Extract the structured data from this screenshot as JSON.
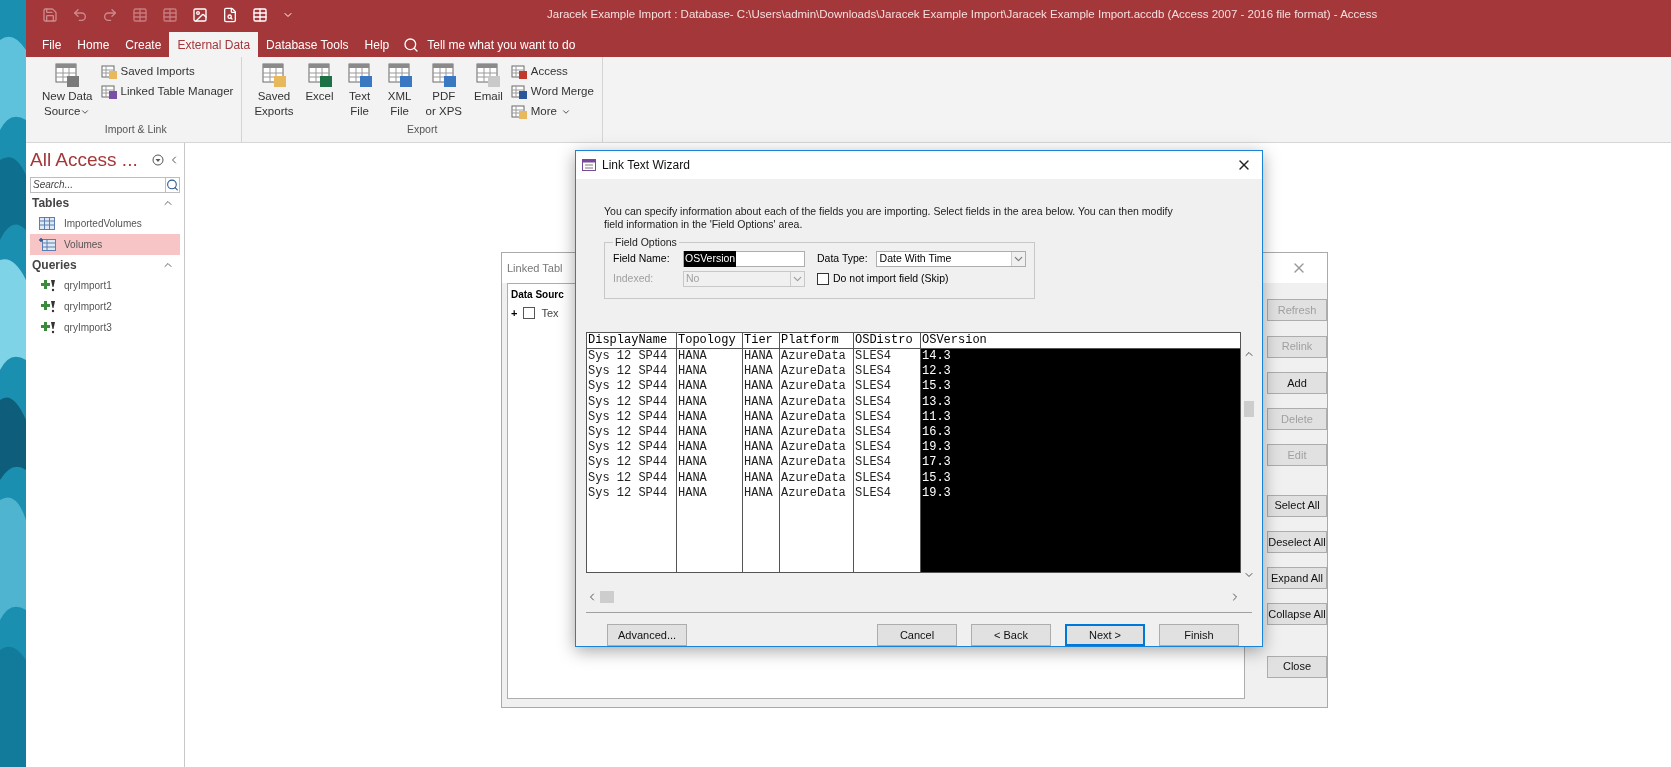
{
  "app_window": {
    "title": "Jaracek Example Import : Database- C:\\Users\\admin\\Downloads\\Jaracek Example Import\\Jaracek Example Import.accdb (Access 2007 - 2016 file format)  -  Access"
  },
  "ribbon_tabs": [
    {
      "label": "File",
      "selected": false
    },
    {
      "label": "Home",
      "selected": false
    },
    {
      "label": "Create",
      "selected": false
    },
    {
      "label": "External Data",
      "selected": true
    },
    {
      "label": "Database Tools",
      "selected": false
    },
    {
      "label": "Help",
      "selected": false
    }
  ],
  "tell_me": "Tell me what you want to do",
  "ribbon_groups": [
    {
      "label": "Import & Link",
      "items": [
        {
          "kind": "large",
          "lines": [
            "New Data",
            "Source"
          ],
          "dropdown": true
        },
        {
          "kind": "small",
          "lines": [
            "Saved Imports"
          ],
          "dropdown": false
        },
        {
          "kind": "small",
          "lines": [
            "Linked Table Manager"
          ],
          "dropdown": false
        }
      ]
    },
    {
      "label": "Export",
      "items": [
        {
          "kind": "large",
          "lines": [
            "Saved",
            "Exports"
          ],
          "dropdown": false
        },
        {
          "kind": "large",
          "lines": [
            "Excel"
          ],
          "dropdown": false
        },
        {
          "kind": "large",
          "lines": [
            "Text",
            "File"
          ],
          "dropdown": false
        },
        {
          "kind": "large",
          "lines": [
            "XML",
            "File"
          ],
          "dropdown": false
        },
        {
          "kind": "large",
          "lines": [
            "PDF",
            "or XPS"
          ],
          "dropdown": false
        },
        {
          "kind": "large",
          "lines": [
            "Email"
          ],
          "dropdown": false
        },
        {
          "kind": "small",
          "lines": [
            "Access"
          ],
          "dropdown": false
        },
        {
          "kind": "small",
          "lines": [
            "Word Merge"
          ],
          "dropdown": false
        },
        {
          "kind": "small",
          "lines": [
            "More"
          ],
          "dropdown": true
        }
      ]
    }
  ],
  "nav_pane": {
    "title": "All Access ...",
    "search_placeholder": "Search...",
    "sections": [
      {
        "label": "Tables",
        "items": [
          {
            "label": "ImportedVolumes",
            "kind": "table",
            "selected": false
          },
          {
            "label": "Volumes",
            "kind": "linked_table",
            "selected": true
          }
        ]
      },
      {
        "label": "Queries",
        "items": [
          {
            "label": "qryImport1",
            "kind": "query",
            "selected": false
          },
          {
            "label": "qryImport2",
            "kind": "query",
            "selected": false
          },
          {
            "label": "qryImport3",
            "kind": "query",
            "selected": false
          }
        ]
      }
    ]
  },
  "linked_table_manager": {
    "title": "Linked Tabl",
    "tree_header": "Data Sourc",
    "tree_items": [
      {
        "expander": "+",
        "label": "Tex",
        "checked": false
      }
    ],
    "buttons": [
      {
        "label": "Refresh",
        "disabled": true
      },
      {
        "label": "Relink",
        "disabled": true
      },
      {
        "label": "Add",
        "disabled": false
      },
      {
        "label": "Delete",
        "disabled": true
      },
      {
        "label": "Edit",
        "disabled": true
      },
      {
        "label": "Select All",
        "disabled": false
      },
      {
        "label": "Deselect All",
        "disabled": false
      },
      {
        "label": "Expand All",
        "disabled": false
      },
      {
        "label": "Collapse All",
        "disabled": false
      },
      {
        "label": "Close",
        "disabled": false
      }
    ]
  },
  "wizard": {
    "title": "Link Text Wizard",
    "instructions": "You can specify information about each of the fields you are importing. Select fields in the area below. You can then modify field information in the 'Field Options' area.",
    "field_options": {
      "legend": "Field Options",
      "field_name_label": "Field Name:",
      "field_name_value": "OSVersion",
      "data_type_label": "Data Type:",
      "data_type_value": "Date With Time",
      "indexed_label": "Indexed:",
      "indexed_value": "No",
      "indexed_disabled": true,
      "skip_label": "Do not import field (Skip)",
      "skip_checked": false
    },
    "table": {
      "columns": [
        {
          "label": "DisplayName",
          "selected": false
        },
        {
          "label": "Topology",
          "selected": false
        },
        {
          "label": "Tier",
          "selected": false
        },
        {
          "label": "Platform",
          "selected": false
        },
        {
          "label": "OSDistro",
          "selected": false
        },
        {
          "label": "OSVersion",
          "selected": true
        }
      ],
      "rows": [
        [
          "Sys 12 SP44",
          "HANA",
          "HANA",
          "AzureData",
          "SLES4",
          "14.3"
        ],
        [
          "Sys 12 SP44",
          "HANA",
          "HANA",
          "AzureData",
          "SLES4",
          "12.3"
        ],
        [
          "Sys 12 SP44",
          "HANA",
          "HANA",
          "AzureData",
          "SLES4",
          "15.3"
        ],
        [
          "Sys 12 SP44",
          "HANA",
          "HANA",
          "AzureData",
          "SLES4",
          "13.3"
        ],
        [
          "Sys 12 SP44",
          "HANA",
          "HANA",
          "AzureData",
          "SLES4",
          "11.3"
        ],
        [
          "Sys 12 SP44",
          "HANA",
          "HANA",
          "AzureData",
          "SLES4",
          "16.3"
        ],
        [
          "Sys 12 SP44",
          "HANA",
          "HANA",
          "AzureData",
          "SLES4",
          "19.3"
        ],
        [
          "Sys 12 SP44",
          "HANA",
          "HANA",
          "AzureData",
          "SLES4",
          "17.3"
        ],
        [
          "Sys 12 SP44",
          "HANA",
          "HANA",
          "AzureData",
          "SLES4",
          "15.3"
        ],
        [
          "Sys 12 SP44",
          "HANA",
          "HANA",
          "AzureData",
          "SLES4",
          "19.3"
        ]
      ]
    },
    "buttons": [
      {
        "label": "Advanced...",
        "default": false
      },
      {
        "label": "Cancel",
        "default": false
      },
      {
        "label": "< Back",
        "default": false
      },
      {
        "label": "Next >",
        "default": true
      },
      {
        "label": "Finish",
        "default": false
      }
    ]
  }
}
